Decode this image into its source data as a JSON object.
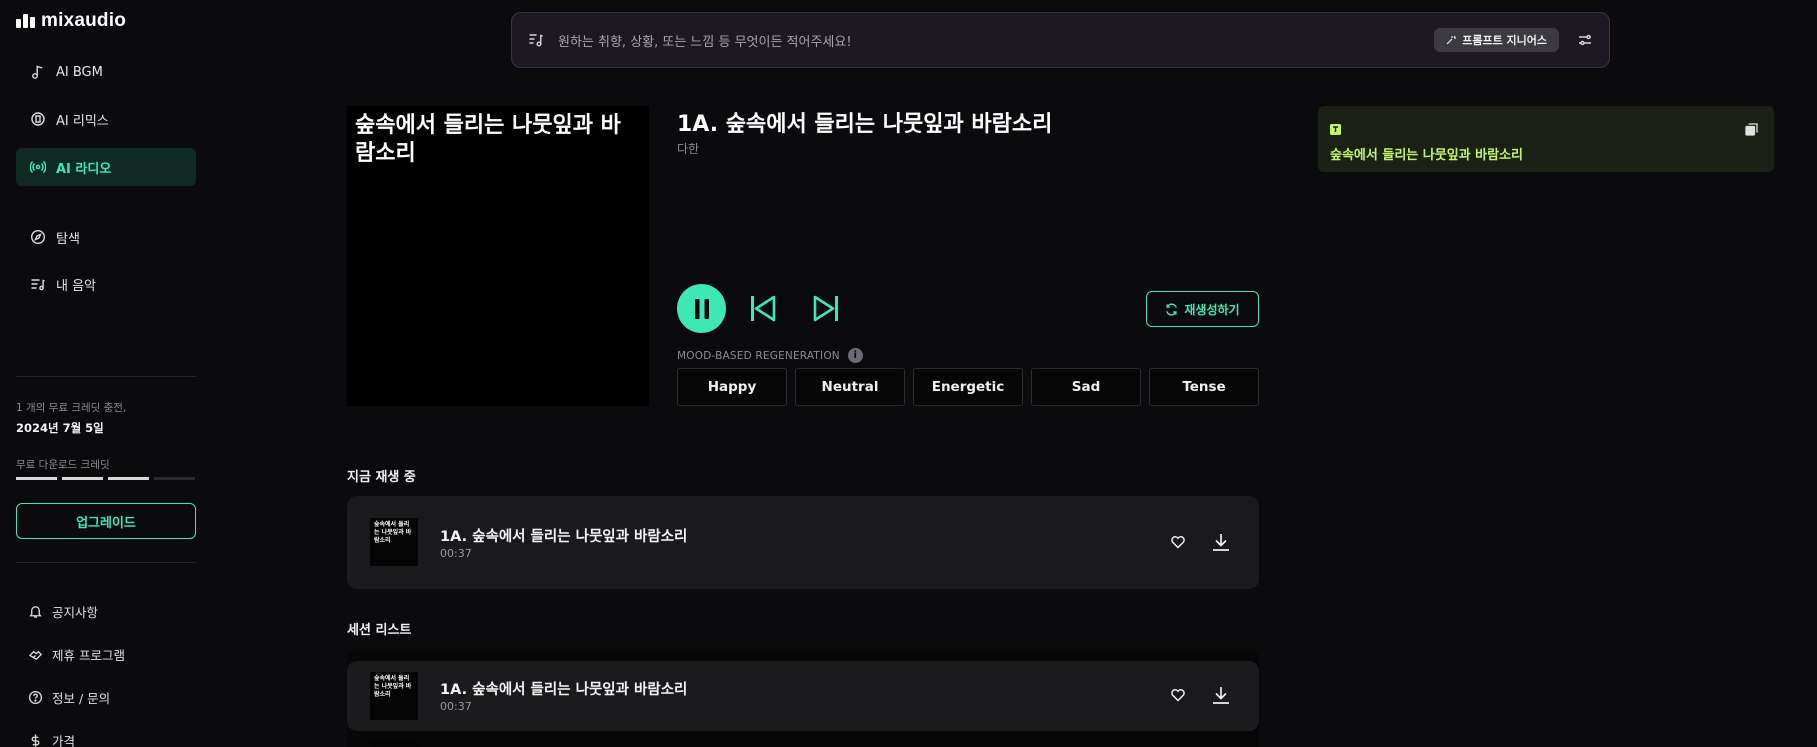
{
  "app": {
    "logo_text": "mixaudio"
  },
  "sidebar": {
    "items": [
      {
        "label": "AI BGM",
        "icon": "music-note-icon"
      },
      {
        "label": "AI 리믹스",
        "icon": "remix-icon"
      },
      {
        "label": "AI 라디오",
        "icon": "radio-icon",
        "active": true
      },
      {
        "label": "탐색",
        "icon": "compass-icon"
      },
      {
        "label": "내 음악",
        "icon": "playlist-icon"
      }
    ],
    "credit_note": "1 개의 무료 크레딧 충전,",
    "credit_date": "2024년 7월 5일",
    "download_label": "무료 다운로드 크레딧",
    "download_progress": 0.75,
    "upgrade_label": "업그레이드",
    "footer": [
      {
        "label": "공지사항",
        "icon": "bell-icon"
      },
      {
        "label": "제휴 프로그램",
        "icon": "handshake-icon"
      },
      {
        "label": "정보 / 문의",
        "icon": "question-icon"
      },
      {
        "label": "가격",
        "icon": "dollar-icon"
      }
    ]
  },
  "prompt": {
    "placeholder": "원하는 취향, 상황, 또는 느낌 등 무엇이든 적어주세요!",
    "genius_label": "프롬프트 지니어스"
  },
  "player": {
    "cover_title": "숲속에서 들리는 나뭇잎과 바람소리",
    "title": "1A. 숲속에서 들리는 나뭇잎과 바람소리",
    "artist": "다한",
    "regenerate_label": "재생성하기",
    "mood_label": "MOOD-BASED REGENERATION",
    "moods": [
      "Happy",
      "Neutral",
      "Energetic",
      "Sad",
      "Tense"
    ]
  },
  "lyric": {
    "text": "숲속에서 들리는 나뭇잎과 바람소리"
  },
  "now_playing": {
    "title": "지금 재생 중",
    "track": {
      "thumb": "숲속에서 들리는 나뭇잎과 바람소리",
      "title": "1A. 숲속에서 들리는 나뭇잎과 바람소리",
      "duration": "00:37"
    }
  },
  "session": {
    "title": "세션 리스트",
    "tracks": [
      {
        "thumb": "숲속에서 들리는 나뭇잎과 바람소리",
        "title": "1A. 숲속에서 들리는 나뭇잎과 바람소리",
        "duration": "00:37"
      }
    ]
  },
  "colors": {
    "accent": "#3ee8b5",
    "lyric_text": "#c6f56c",
    "background": "#0b0b0d"
  }
}
